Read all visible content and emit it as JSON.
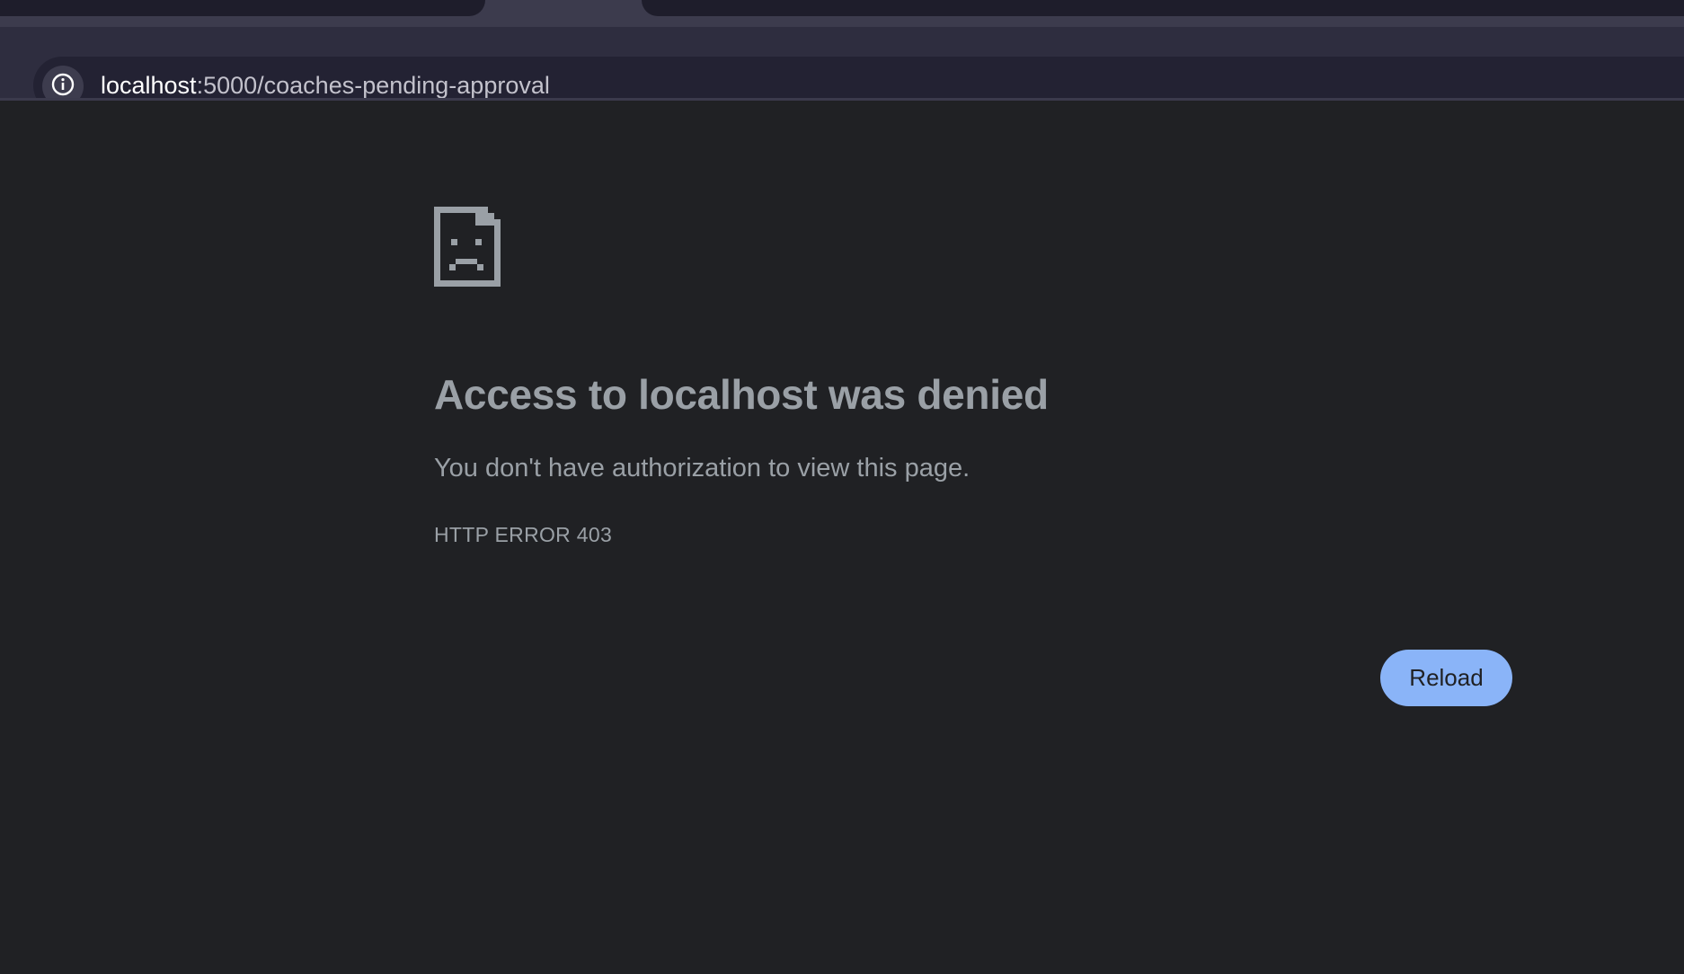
{
  "browser": {
    "url_host": "localhost",
    "url_path": ":5000/coaches-pending-approval",
    "site_info_icon": "info-icon"
  },
  "error_page": {
    "icon": "sad-document-icon",
    "title": "Access to localhost was denied",
    "description": "You don't have authorization to view this page.",
    "error_code": "HTTP ERROR 403",
    "reload_label": "Reload"
  },
  "colors": {
    "page_background": "#202124",
    "text": "#9aa0a6",
    "button_accent": "#8ab4f8",
    "toolbar": "#2e2d3f",
    "omnibox": "#232233"
  }
}
